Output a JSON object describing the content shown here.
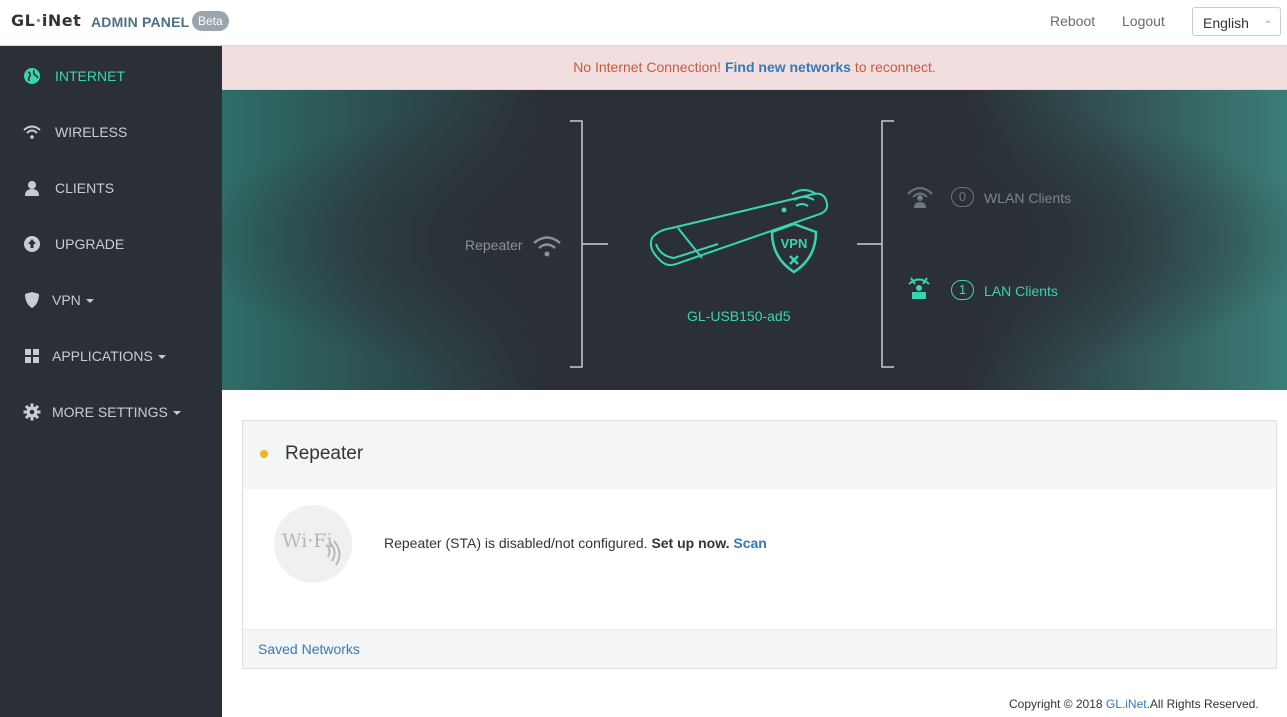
{
  "header": {
    "logo_prefix": "GL",
    "logo_dot": "·",
    "logo_suffix": "iNet",
    "admin_title": "ADMIN PANEL",
    "beta": "Beta",
    "reboot": "Reboot",
    "logout": "Logout",
    "language": "English"
  },
  "sidebar": {
    "items": [
      {
        "label": "INTERNET",
        "icon": "globe-icon",
        "active": true
      },
      {
        "label": "WIRELESS",
        "icon": "wifi-icon"
      },
      {
        "label": "CLIENTS",
        "icon": "user-icon"
      },
      {
        "label": "UPGRADE",
        "icon": "upload-icon"
      },
      {
        "label": "VPN",
        "icon": "shield-icon",
        "dropdown": true
      },
      {
        "label": "APPLICATIONS",
        "icon": "grid-icon",
        "dropdown": true
      },
      {
        "label": "MORE SETTINGS",
        "icon": "gear-icon",
        "dropdown": true
      }
    ]
  },
  "alert": {
    "prefix": "No Internet Connection!",
    "link": "Find new networks",
    "suffix": "to reconnect."
  },
  "topology": {
    "left_label": "Repeater",
    "device_name": "GL-USB150-ad5",
    "vpn_badge": "VPN",
    "wlan_count": "0",
    "wlan_label": "WLAN Clients",
    "lan_count": "1",
    "lan_label": "LAN Clients"
  },
  "panel": {
    "title": "Repeater",
    "message": "Repeater (STA) is disabled/not configured.",
    "setup": "Set up now.",
    "scan": "Scan",
    "saved_networks": "Saved Networks",
    "wifi_text": "Wi·Fi"
  },
  "footer": {
    "copyright_prefix": "Copyright © 2018",
    "brand": "GL.iNet",
    "suffix": ".All Rights Reserved."
  },
  "colors": {
    "accent": "#36d6b2",
    "sidebar_bg": "#2b3037",
    "alert_bg": "#f2dede",
    "link": "#337ab7",
    "status_dot": "#f0b51b"
  }
}
